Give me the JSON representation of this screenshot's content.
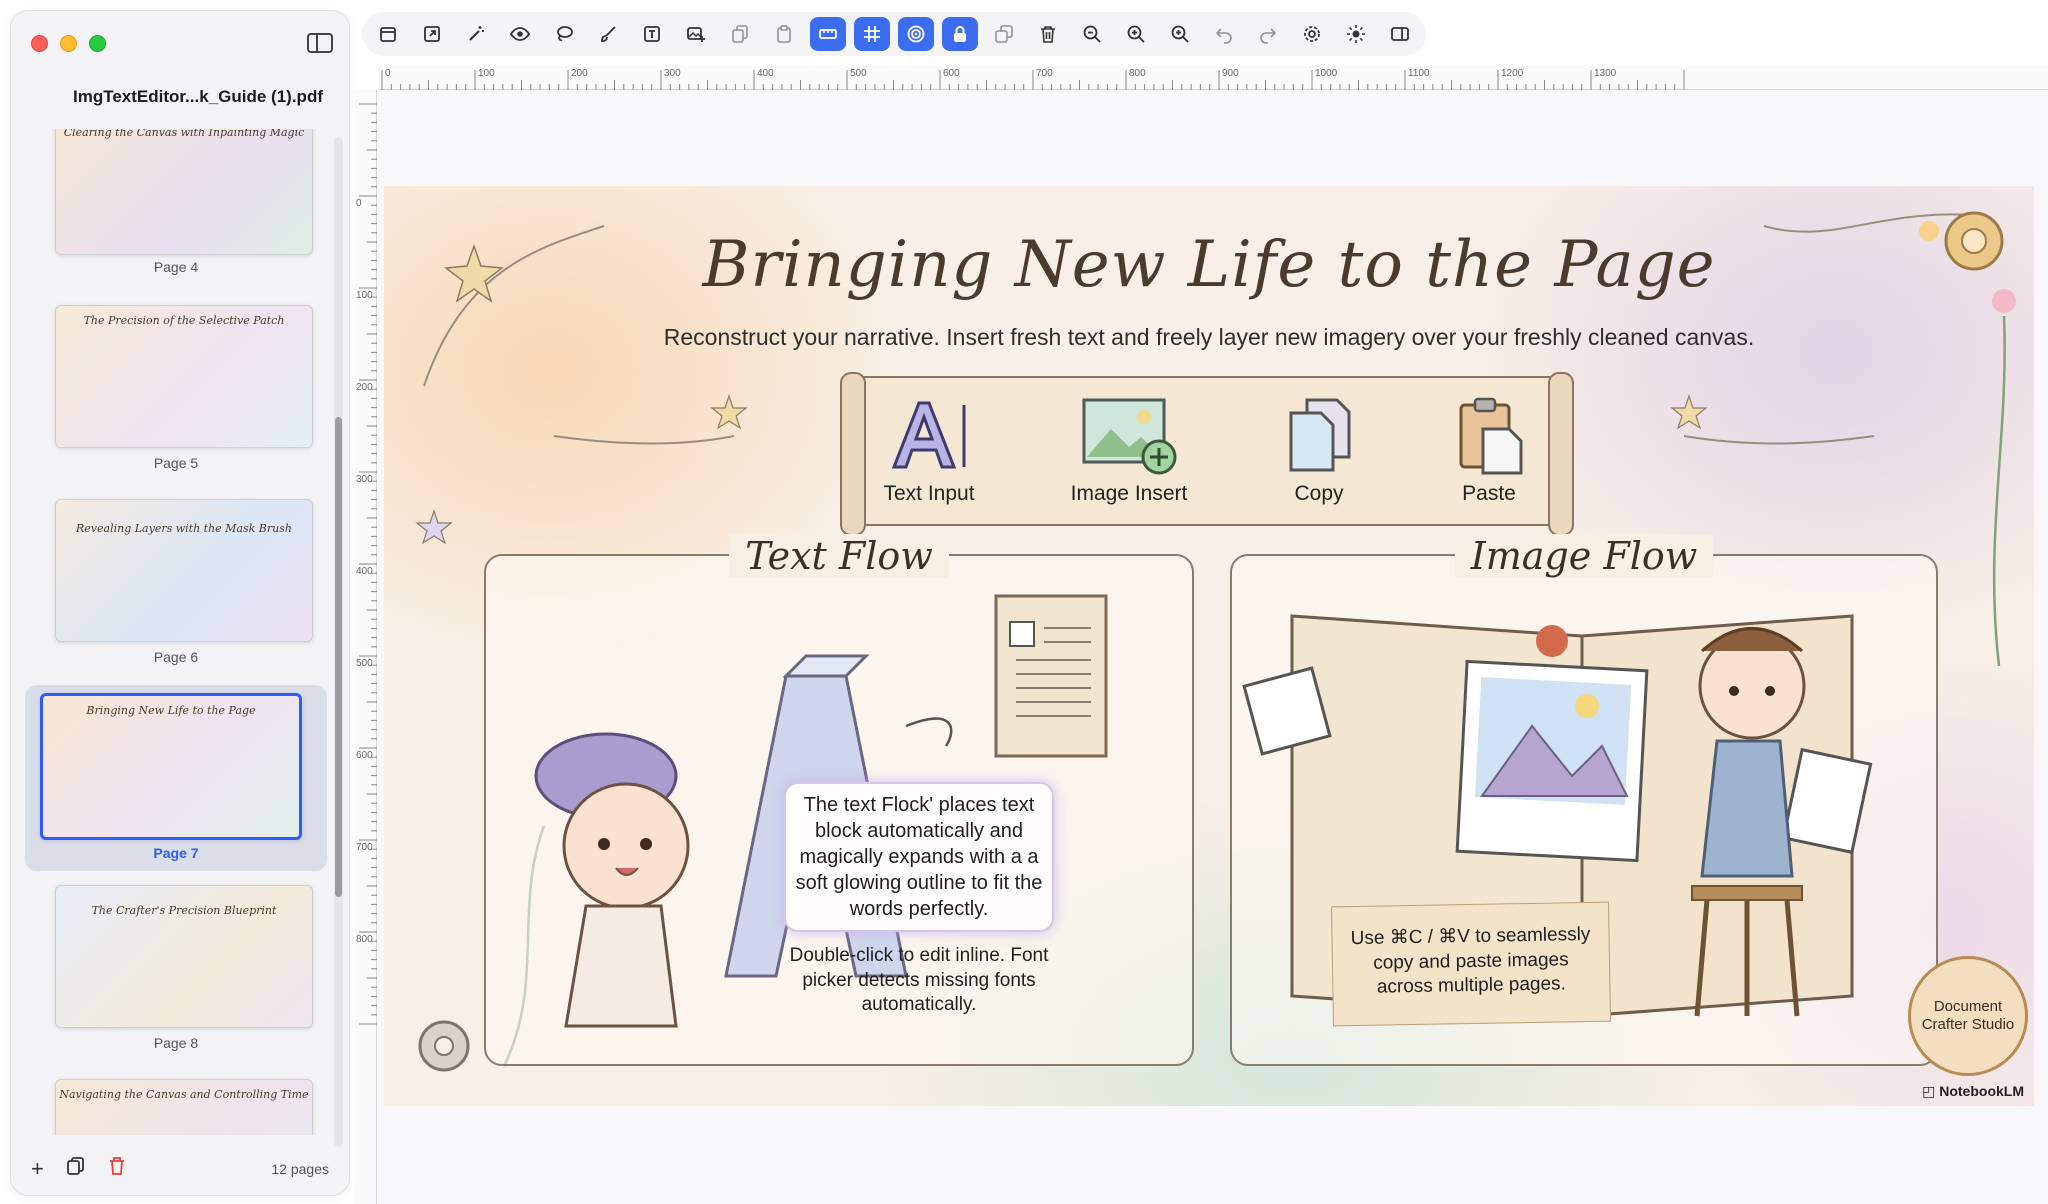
{
  "sidebar": {
    "doc_title": "ImgTextEditor...k_Guide (1).pdf",
    "page_count": "12 pages",
    "thumbnails": [
      {
        "title": "Clearing the Canvas with Inpainting Magic",
        "label": "Page 4"
      },
      {
        "title": "The Precision of the Selective Patch",
        "label": "Page 5"
      },
      {
        "title": "Revealing Layers with the Mask Brush",
        "label": "Page 6"
      },
      {
        "title": "Bringing New Life to the Page",
        "label": "Page 7"
      },
      {
        "title": "The Crafter's Precision Blueprint",
        "label": "Page 8"
      },
      {
        "title": "Navigating the Canvas and Controlling Time",
        "label": ""
      }
    ]
  },
  "toolbar": {
    "buttons": [
      "select-icon",
      "export-icon",
      "magic-wand-icon",
      "eye-icon",
      "lasso-icon",
      "brush-icon",
      "text-icon",
      "image-add-icon",
      "copy-icon",
      "paste-icon",
      "ruler-icon",
      "grid-icon",
      "target-icon",
      "lock-icon",
      "duplicate-icon",
      "trash-icon",
      "zoom-out-icon",
      "zoom-in-icon",
      "zoom-fit-icon",
      "undo-icon",
      "redo-icon",
      "settings-icon",
      "brightness-icon",
      "panel-icon"
    ],
    "active": [
      "ruler-icon",
      "grid-icon",
      "target-icon",
      "lock-icon"
    ]
  },
  "rulers": {
    "h_ticks": [
      "0",
      "100",
      "200",
      "300",
      "400",
      "500",
      "600",
      "700",
      "800",
      "900",
      "1000",
      "1100",
      "1200",
      "1300"
    ],
    "v_ticks": [
      "0",
      "100",
      "200",
      "300",
      "400",
      "500",
      "600",
      "700",
      "800"
    ]
  },
  "slide": {
    "title": "Bringing New Life to the Page",
    "subtitle": "Reconstruct your narrative. Insert fresh text and freely layer new imagery over your freshly cleaned canvas.",
    "tools": [
      "Text Input",
      "Image Insert",
      "Copy",
      "Paste"
    ],
    "text_flow": {
      "title": "Text Flow",
      "callout": "The text Flock' places text block automatically and magically expands with a a soft glowing outline to fit the words perfectly.",
      "note": "Double-click to edit inline. Font picker detects missing fonts automatically."
    },
    "image_flow": {
      "title": "Image Flow",
      "note": "Use ⌘C / ⌘V to seamlessly copy and paste images across multiple pages."
    },
    "seal": "Document Crafter Studio",
    "brand": "NotebookLM"
  }
}
